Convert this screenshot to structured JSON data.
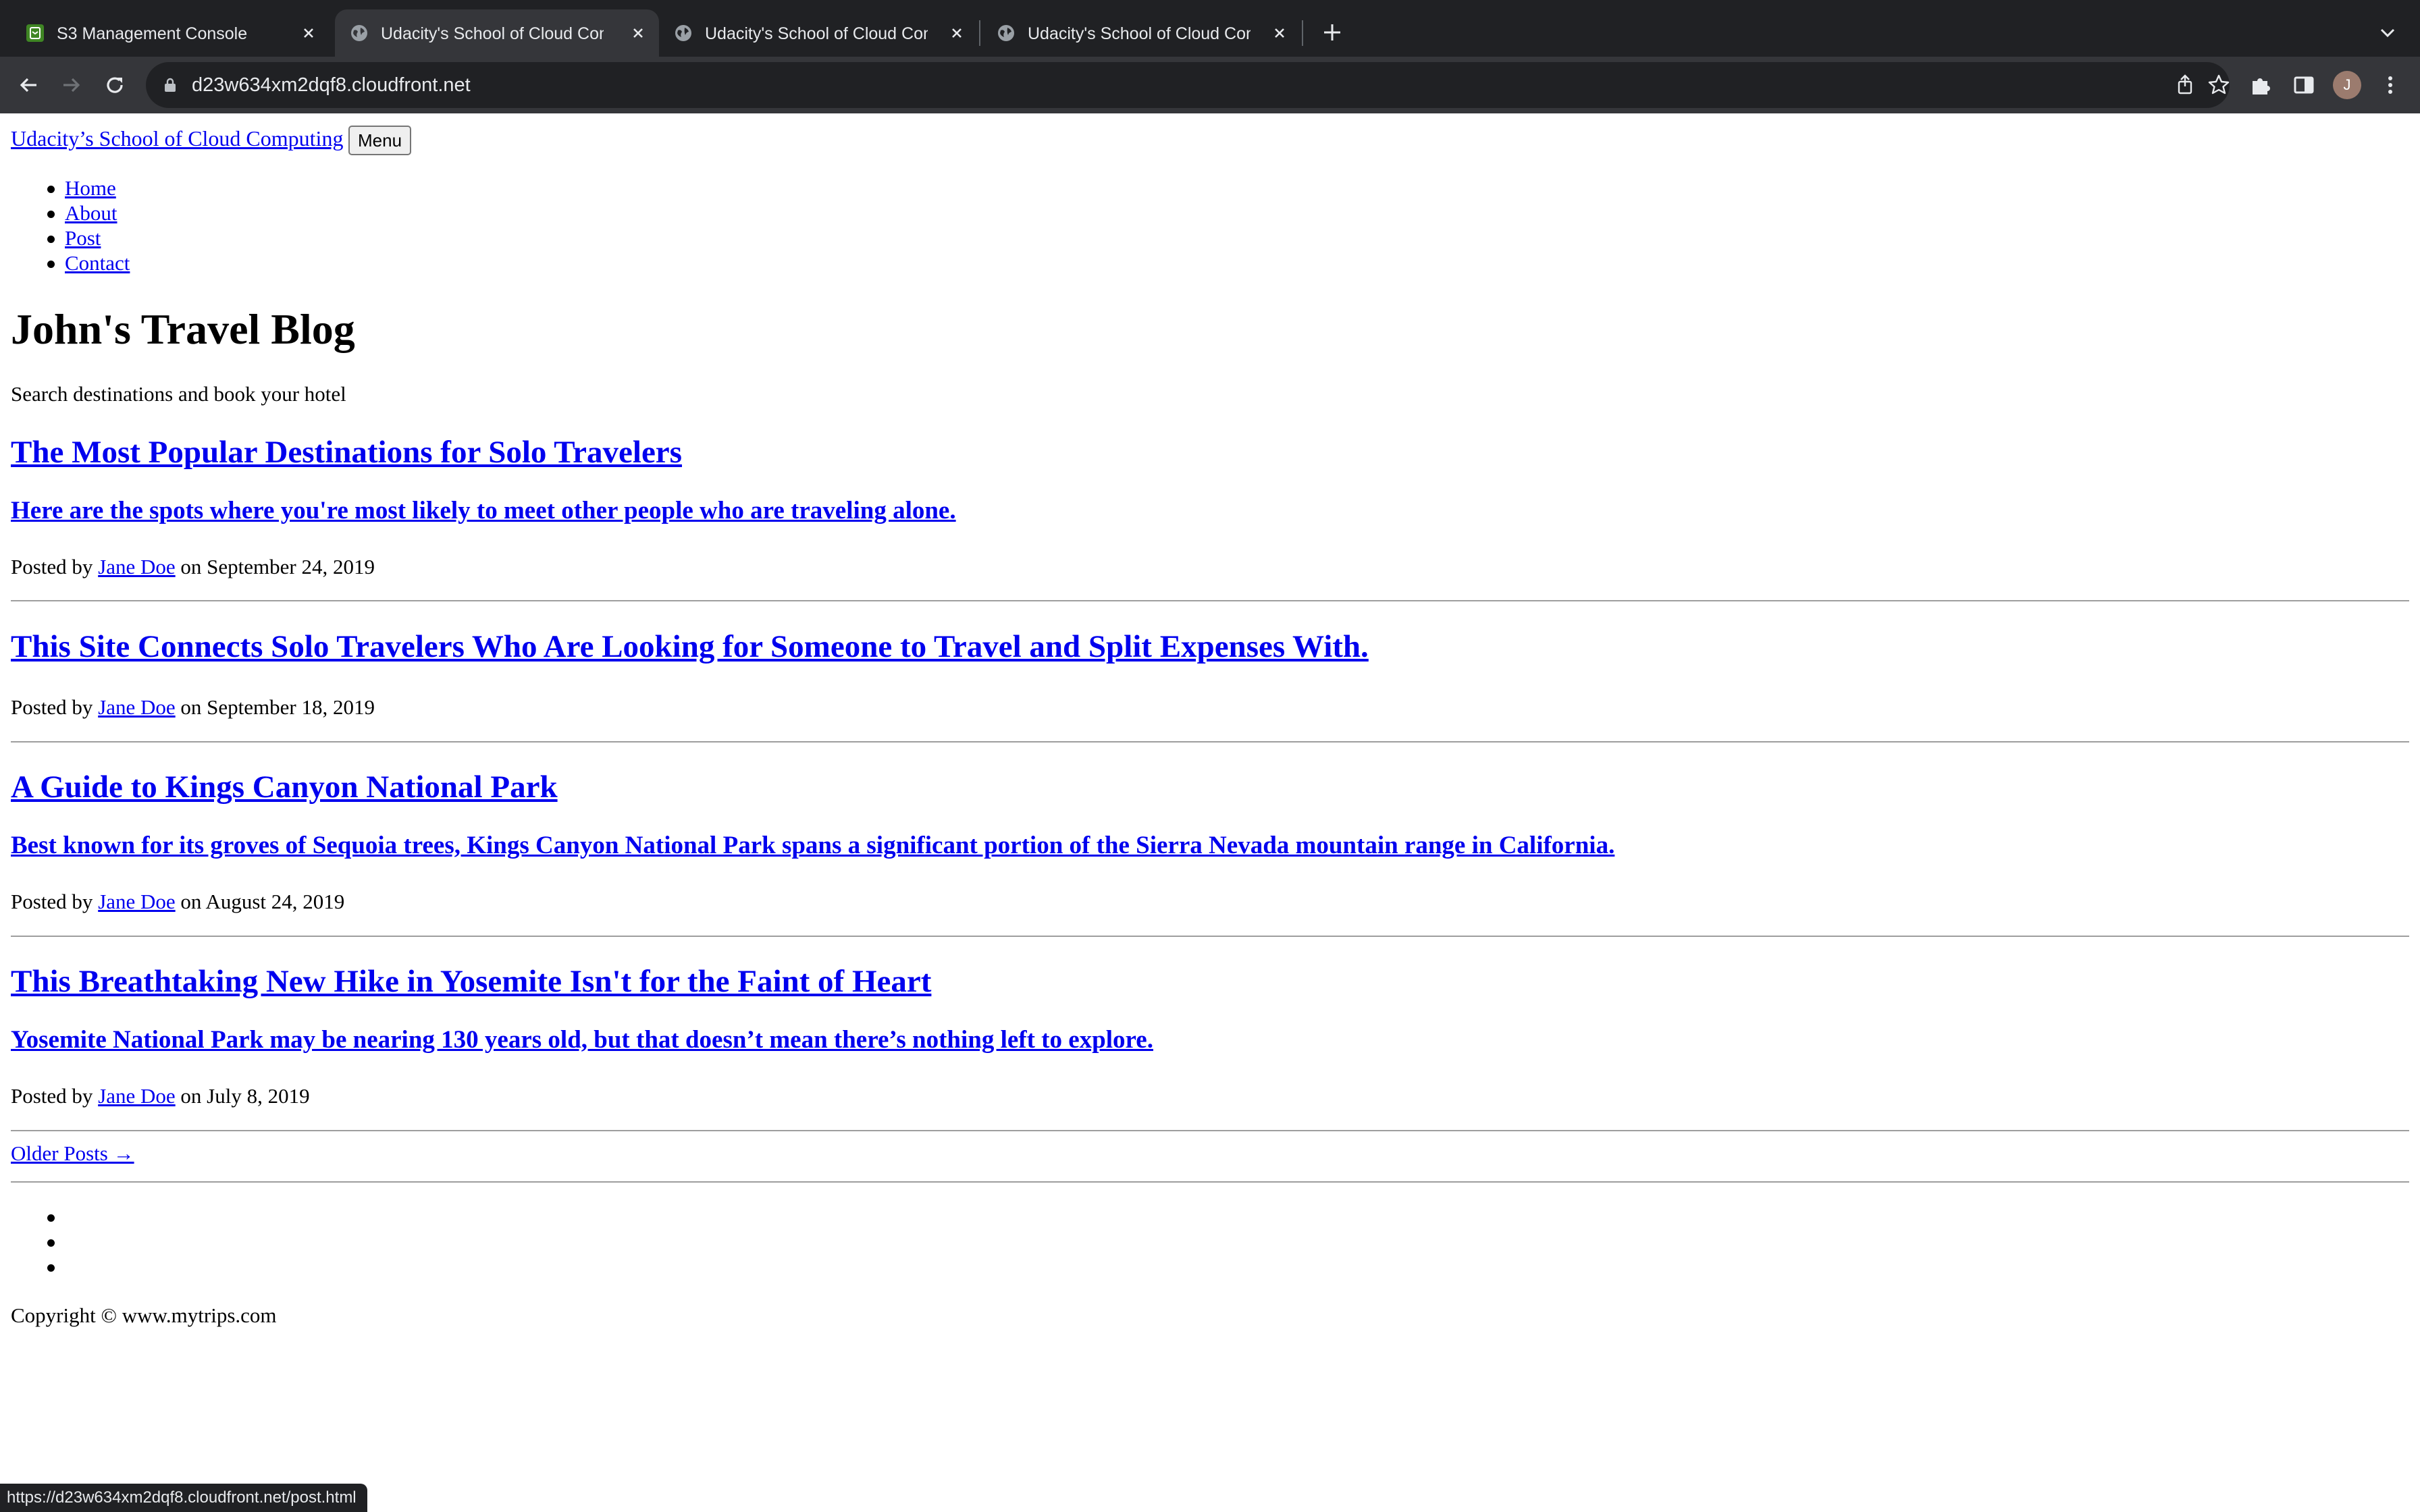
{
  "browser": {
    "tabs": [
      {
        "title": "S3 Management Console",
        "active": false,
        "favicon": "aws-s3-icon"
      },
      {
        "title": "Udacity's School of Cloud Computing",
        "active": true,
        "favicon": "globe-icon"
      },
      {
        "title": "Udacity's School of Cloud Computing",
        "active": false,
        "favicon": "globe-icon"
      },
      {
        "title": "Udacity's School of Cloud Computing",
        "active": false,
        "favicon": "globe-icon"
      }
    ],
    "url": "d23w634xm2dqf8.cloudfront.net",
    "profile_initial": "J",
    "status_url": "https://d23w634xm2dqf8.cloudfront.net/post.html",
    "colors": {
      "chrome_dark": "#202124",
      "chrome_toolbar": "#35363a",
      "chrome_text": "#e8eaed",
      "link": "#0000ee"
    }
  },
  "page": {
    "brand": "Udacity’s School of Cloud Computing",
    "menu_button": "Menu",
    "nav": [
      "Home",
      "About",
      "Post",
      "Contact"
    ],
    "title": "John's Travel Blog",
    "subheading": "Search destinations and book your hotel",
    "posts": [
      {
        "title": "The Most Popular Destinations for Solo Travelers",
        "subtitle": "Here are the spots where you're most likely to meet other people who are traveling alone.",
        "meta_prefix": "Posted by",
        "author": "Jane Doe",
        "meta_suffix": "on September 24, 2019"
      },
      {
        "title": "This Site Connects Solo Travelers Who Are Looking for Someone to Travel and Split Expenses With.",
        "subtitle": "",
        "meta_prefix": "Posted by",
        "author": "Jane Doe",
        "meta_suffix": "on September 18, 2019"
      },
      {
        "title": "A Guide to Kings Canyon National Park",
        "subtitle": "Best known for its groves of Sequoia trees, Kings Canyon National Park spans a significant portion of the Sierra Nevada mountain range in California.",
        "meta_prefix": "Posted by",
        "author": "Jane Doe",
        "meta_suffix": "on August 24, 2019"
      },
      {
        "title": "This Breathtaking New Hike in Yosemite Isn't for the Faint of Heart",
        "subtitle": "Yosemite National Park may be nearing 130 years old, but that doesn’t mean there’s nothing left to explore.",
        "meta_prefix": "Posted by",
        "author": "Jane Doe",
        "meta_suffix": "on July 8, 2019"
      }
    ],
    "older_posts": "Older Posts →",
    "copyright": "Copyright © www.mytrips.com"
  }
}
